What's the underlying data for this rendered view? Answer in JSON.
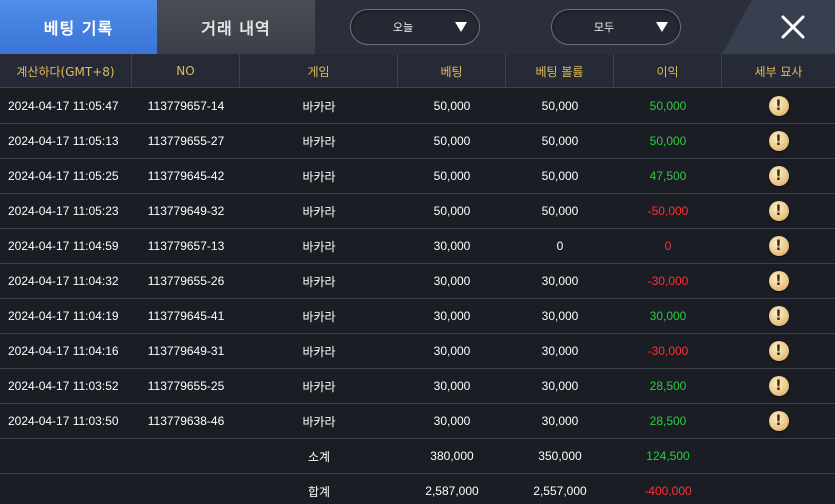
{
  "tabs": {
    "active_label": "베팅 기록",
    "inactive_label": "거래 내역"
  },
  "filters": {
    "date_value": "오늘",
    "type_value": "모두"
  },
  "colors": {
    "positive": "#2ecc40",
    "negative": "#ff3030",
    "header_text": "#e0bc58",
    "active_tab": "#4f8ee8"
  },
  "icons": {
    "close": "close-icon",
    "dropdown": "triangle-down-icon",
    "info": "exclamation-info-icon"
  },
  "table": {
    "headers": [
      "계산하다(GMT+8)",
      "NO",
      "게임",
      "베팅",
      "베팅 볼륨",
      "이익",
      "세부 묘사"
    ],
    "rows": [
      {
        "time": "2024-04-17 11:05:47",
        "no": "113779657-14",
        "game": "바카라",
        "bet": "50,000",
        "volume": "50,000",
        "profit": "50,000",
        "profit_sign": "positive"
      },
      {
        "time": "2024-04-17 11:05:13",
        "no": "113779655-27",
        "game": "바카라",
        "bet": "50,000",
        "volume": "50,000",
        "profit": "50,000",
        "profit_sign": "positive"
      },
      {
        "time": "2024-04-17 11:05:25",
        "no": "113779645-42",
        "game": "바카라",
        "bet": "50,000",
        "volume": "50,000",
        "profit": "47,500",
        "profit_sign": "positive"
      },
      {
        "time": "2024-04-17 11:05:23",
        "no": "113779649-32",
        "game": "바카라",
        "bet": "50,000",
        "volume": "50,000",
        "profit": "-50,000",
        "profit_sign": "negative"
      },
      {
        "time": "2024-04-17 11:04:59",
        "no": "113779657-13",
        "game": "바카라",
        "bet": "30,000",
        "volume": "0",
        "profit": "0",
        "profit_sign": "negative"
      },
      {
        "time": "2024-04-17 11:04:32",
        "no": "113779655-26",
        "game": "바카라",
        "bet": "30,000",
        "volume": "30,000",
        "profit": "-30,000",
        "profit_sign": "negative"
      },
      {
        "time": "2024-04-17 11:04:19",
        "no": "113779645-41",
        "game": "바카라",
        "bet": "30,000",
        "volume": "30,000",
        "profit": "30,000",
        "profit_sign": "positive"
      },
      {
        "time": "2024-04-17 11:04:16",
        "no": "113779649-31",
        "game": "바카라",
        "bet": "30,000",
        "volume": "30,000",
        "profit": "-30,000",
        "profit_sign": "negative"
      },
      {
        "time": "2024-04-17 11:03:52",
        "no": "113779655-25",
        "game": "바카라",
        "bet": "30,000",
        "volume": "30,000",
        "profit": "28,500",
        "profit_sign": "positive"
      },
      {
        "time": "2024-04-17 11:03:50",
        "no": "113779638-46",
        "game": "바카라",
        "bet": "30,000",
        "volume": "30,000",
        "profit": "28,500",
        "profit_sign": "positive"
      }
    ],
    "subtotal": {
      "label": "소계",
      "bet": "380,000",
      "volume": "350,000",
      "profit": "124,500",
      "profit_sign": "positive"
    },
    "total": {
      "label": "합계",
      "bet": "2,587,000",
      "volume": "2,557,000",
      "profit": "-400,000",
      "profit_sign": "negative"
    }
  }
}
